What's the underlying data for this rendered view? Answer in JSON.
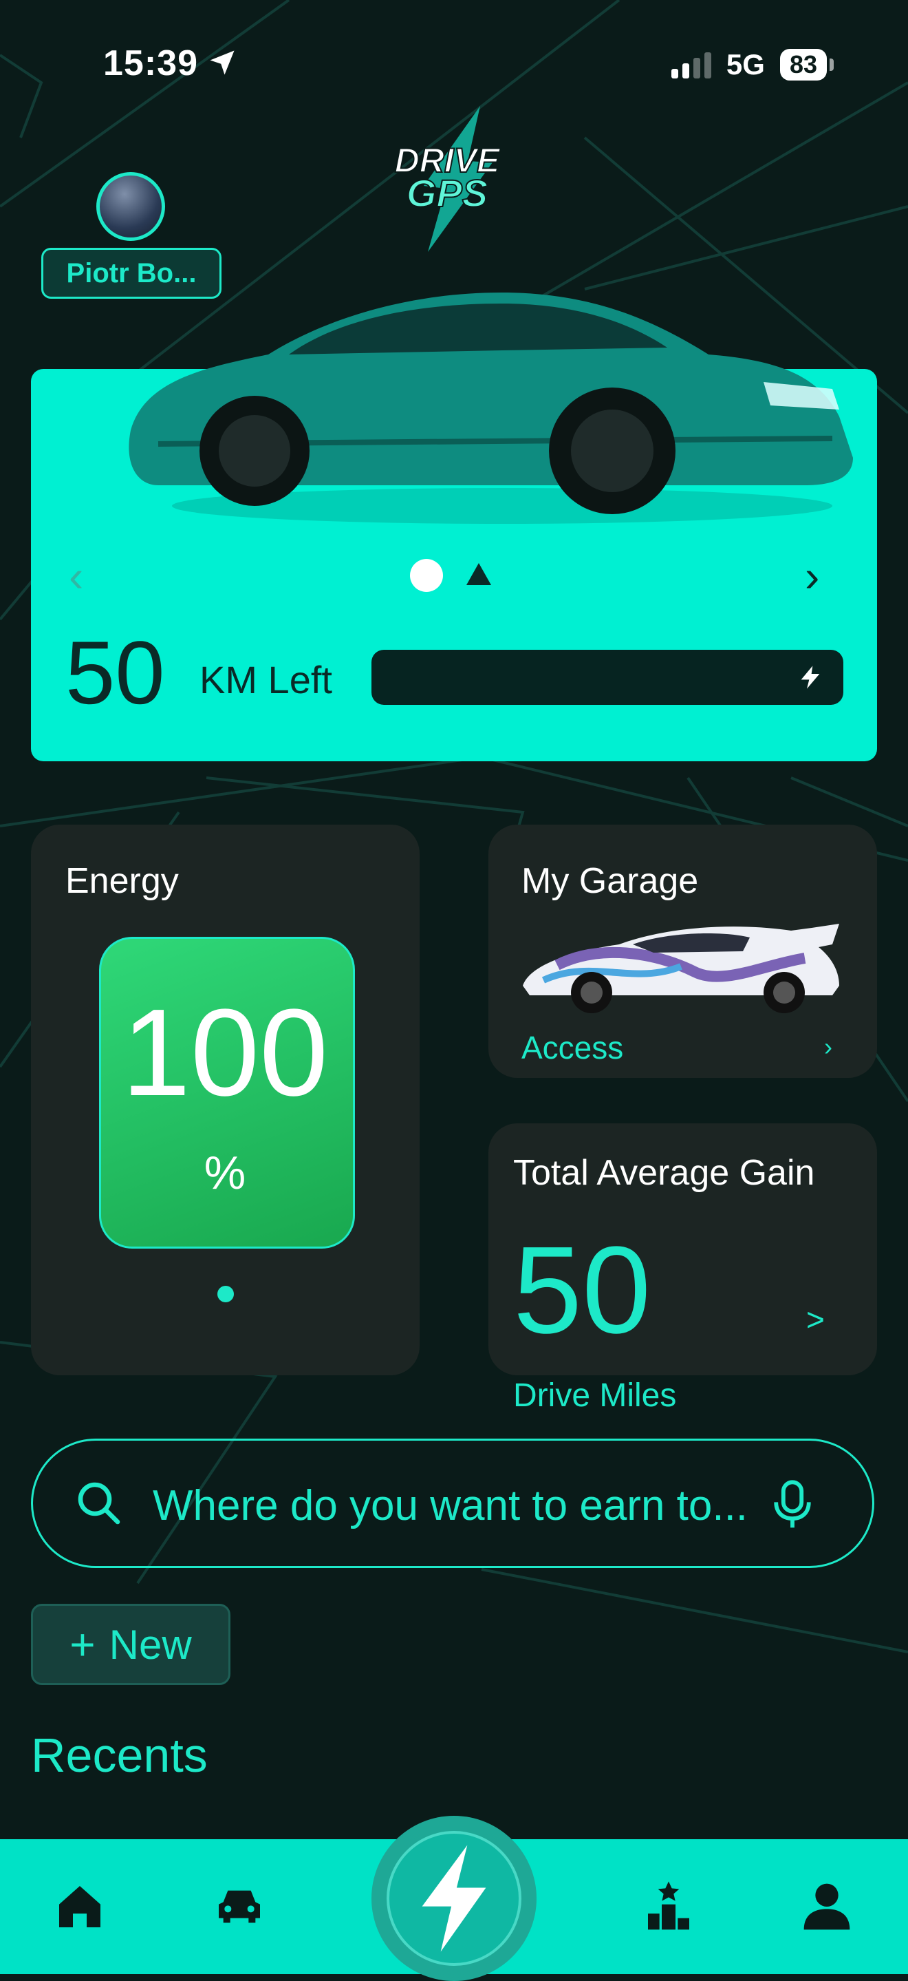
{
  "status_bar": {
    "time": "15:39",
    "network": "5G",
    "battery": "83"
  },
  "header": {
    "user_name": "Piotr Bo...",
    "logo_text_1": "DRIVE",
    "logo_text_2": "GPS"
  },
  "vehicle": {
    "range_value": "50",
    "range_label": "KM Left",
    "prev_label": "‹",
    "next_label": "›",
    "charge_fraction": 0
  },
  "energy": {
    "title": "Energy",
    "value": "100",
    "unit": "%"
  },
  "garage": {
    "title": "My Garage",
    "link": "Access",
    "chevron": "›"
  },
  "gain": {
    "title": "Total Average Gain",
    "value": "50",
    "chevron": ">",
    "unit": "Drive Miles"
  },
  "search": {
    "placeholder": "Where do you want to earn to..."
  },
  "actions": {
    "new_plus": "+",
    "new_label": "New"
  },
  "recents": {
    "title": "Recents"
  },
  "nav": {
    "items": [
      {
        "icon": "home-icon"
      },
      {
        "icon": "car-icon"
      },
      {
        "icon": "bolt-icon"
      },
      {
        "icon": "leaderboard-icon"
      },
      {
        "icon": "profile-icon"
      }
    ]
  },
  "colors": {
    "accent": "#1de9c8",
    "hero": "#00f0d2",
    "background": "#0a1b19",
    "card": "#1c2523",
    "energy_green": "#2fd878"
  }
}
